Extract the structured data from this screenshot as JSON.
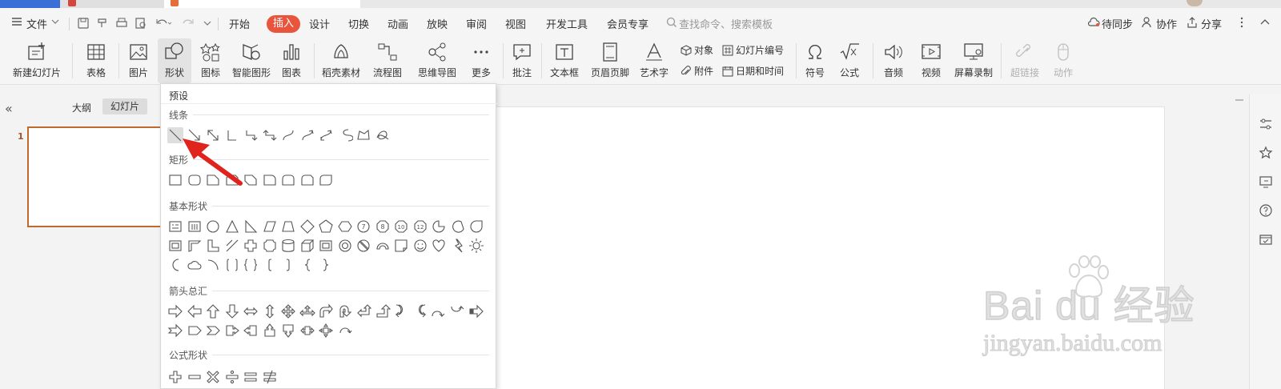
{
  "menu": {
    "file": "文件",
    "tabs": [
      "开始",
      "插入",
      "设计",
      "切换",
      "动画",
      "放映",
      "审阅",
      "视图",
      "开发工具",
      "会员专享"
    ],
    "active_tab": "插入",
    "search_placeholder": "查找命令、搜索模板",
    "sync": "待同步",
    "collab": "协作",
    "share": "分享"
  },
  "ribbon": {
    "new_slide": "新建幻灯片",
    "table": "表格",
    "picture": "图片",
    "shapes": "形状",
    "icons": "图标",
    "smart_art": "智能图形",
    "chart": "图表",
    "material": "稻壳素材",
    "flowchart": "流程图",
    "mindmap": "思维导图",
    "more": "更多",
    "comment": "批注",
    "textbox": "文本框",
    "header_footer": "页眉页脚",
    "word_art": "艺术字",
    "object": "对象",
    "slide_number": "幻灯片编号",
    "attachment": "附件",
    "date_time": "日期和时间",
    "symbol": "符号",
    "formula": "公式",
    "audio": "音频",
    "video": "视频",
    "screen_record": "屏幕录制",
    "hyperlink": "超链接",
    "action": "动作"
  },
  "leftpane": {
    "outline_tab": "大纲",
    "slides_tab": "幻灯片",
    "slide_number": "1"
  },
  "dropdown": {
    "title": "预设",
    "sections": [
      "线条",
      "矩形",
      "基本形状",
      "箭头总汇",
      "公式形状"
    ]
  },
  "watermark": {
    "brand": "Bai du 经验",
    "url": "jingyan.baidu.com"
  },
  "colors": {
    "accent": "#e8553c",
    "thumb_border": "#c0692e",
    "annotation_arrow": "#e0231c"
  }
}
